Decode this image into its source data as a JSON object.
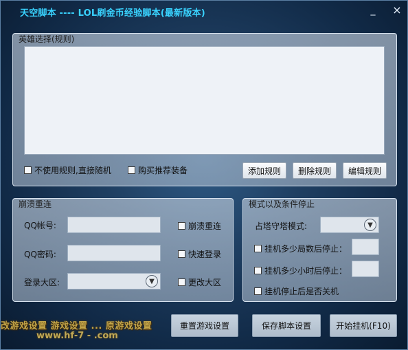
{
  "window": {
    "title": "天空脚本 ---- LOL刷金币经验脚本(最新版本)",
    "minimize_glyph": "_",
    "close_glyph": "×"
  },
  "hero_panel": {
    "title": "英雄选择(规则)",
    "checkbox_random": "不使用规则,直接随机",
    "checkbox_buy": "购买推荐装备",
    "btn_add": "添加规则",
    "btn_delete": "删除规则",
    "btn_edit": "编辑规则"
  },
  "crash_panel": {
    "title": "崩溃重连",
    "qq_account_label": "QQ帐号:",
    "qq_account_value": "",
    "qq_password_label": "QQ密码:",
    "qq_password_value": "",
    "region_label": "登录大区:",
    "region_value": "",
    "chk_reconnect": "崩溃重连",
    "chk_fast_login": "快速登录",
    "chk_change_region": "更改大区"
  },
  "mode_panel": {
    "title": "模式以及条件停止",
    "tower_mode_label": "占塔守塔模式:",
    "tower_mode_value": "",
    "chk_stop_games": "挂机多少局数后停止：",
    "stop_games_value": "",
    "chk_stop_hours": "挂机多少小时后停止：",
    "stop_hours_value": "",
    "chk_shutdown": "挂机停止后是否关机"
  },
  "bottom": {
    "watermark_top": "改游戏设置     游戏设置 ... 原游戏设置",
    "watermark_bottom": "www.hf-7 - .com",
    "btn_reset": "重置游戏设置",
    "btn_save": "保存脚本设置",
    "btn_start": "开始挂机(F10)"
  },
  "colors": {
    "title": "#39d3ff",
    "background": "#1f3f62",
    "panel": "#b8c6d5"
  }
}
